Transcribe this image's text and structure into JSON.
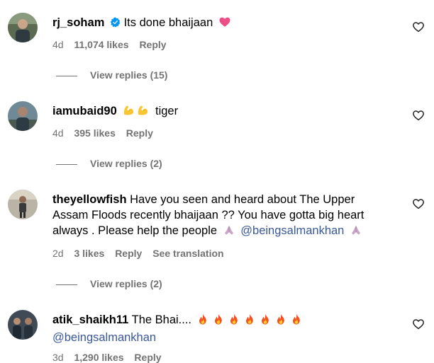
{
  "comments": [
    {
      "username": "rj_soham",
      "text": "Its done bhaijaan",
      "age": "4d",
      "likes": "11,074 likes",
      "reply": "Reply",
      "view_replies": "View replies (15)"
    },
    {
      "username": "iamubaid90",
      "text": "tiger",
      "age": "4d",
      "likes": "395 likes",
      "reply": "Reply",
      "view_replies": "View replies (2)"
    },
    {
      "username": "theyellowfish",
      "text": "Have you seen and heard about The Upper Assam Floods recently bhaijaan ?? You have gotta big heart always . Please help the people",
      "mention": "@beingsalmankhan",
      "age": "2d",
      "likes": "3 likes",
      "reply": "Reply",
      "see_translation": "See translation",
      "view_replies": "View replies (2)"
    },
    {
      "username": "atik_shaikh11",
      "text": "The Bhai....",
      "mention": "@beingsalmankhan",
      "age": "3d",
      "likes": "1,290 likes",
      "reply": "Reply"
    }
  ],
  "icons": {
    "verified": "verified-badge-icon",
    "heart_emoji": "pink-heart-emoji",
    "flexed_biceps": "flexed-biceps-emoji",
    "folded_hands": "folded-hands-emoji",
    "fire": "fire-emoji",
    "like": "heart-outline-icon"
  },
  "colors": {
    "mention": "#385898",
    "secondary_text": "#737373",
    "verified": "#0095f6"
  }
}
